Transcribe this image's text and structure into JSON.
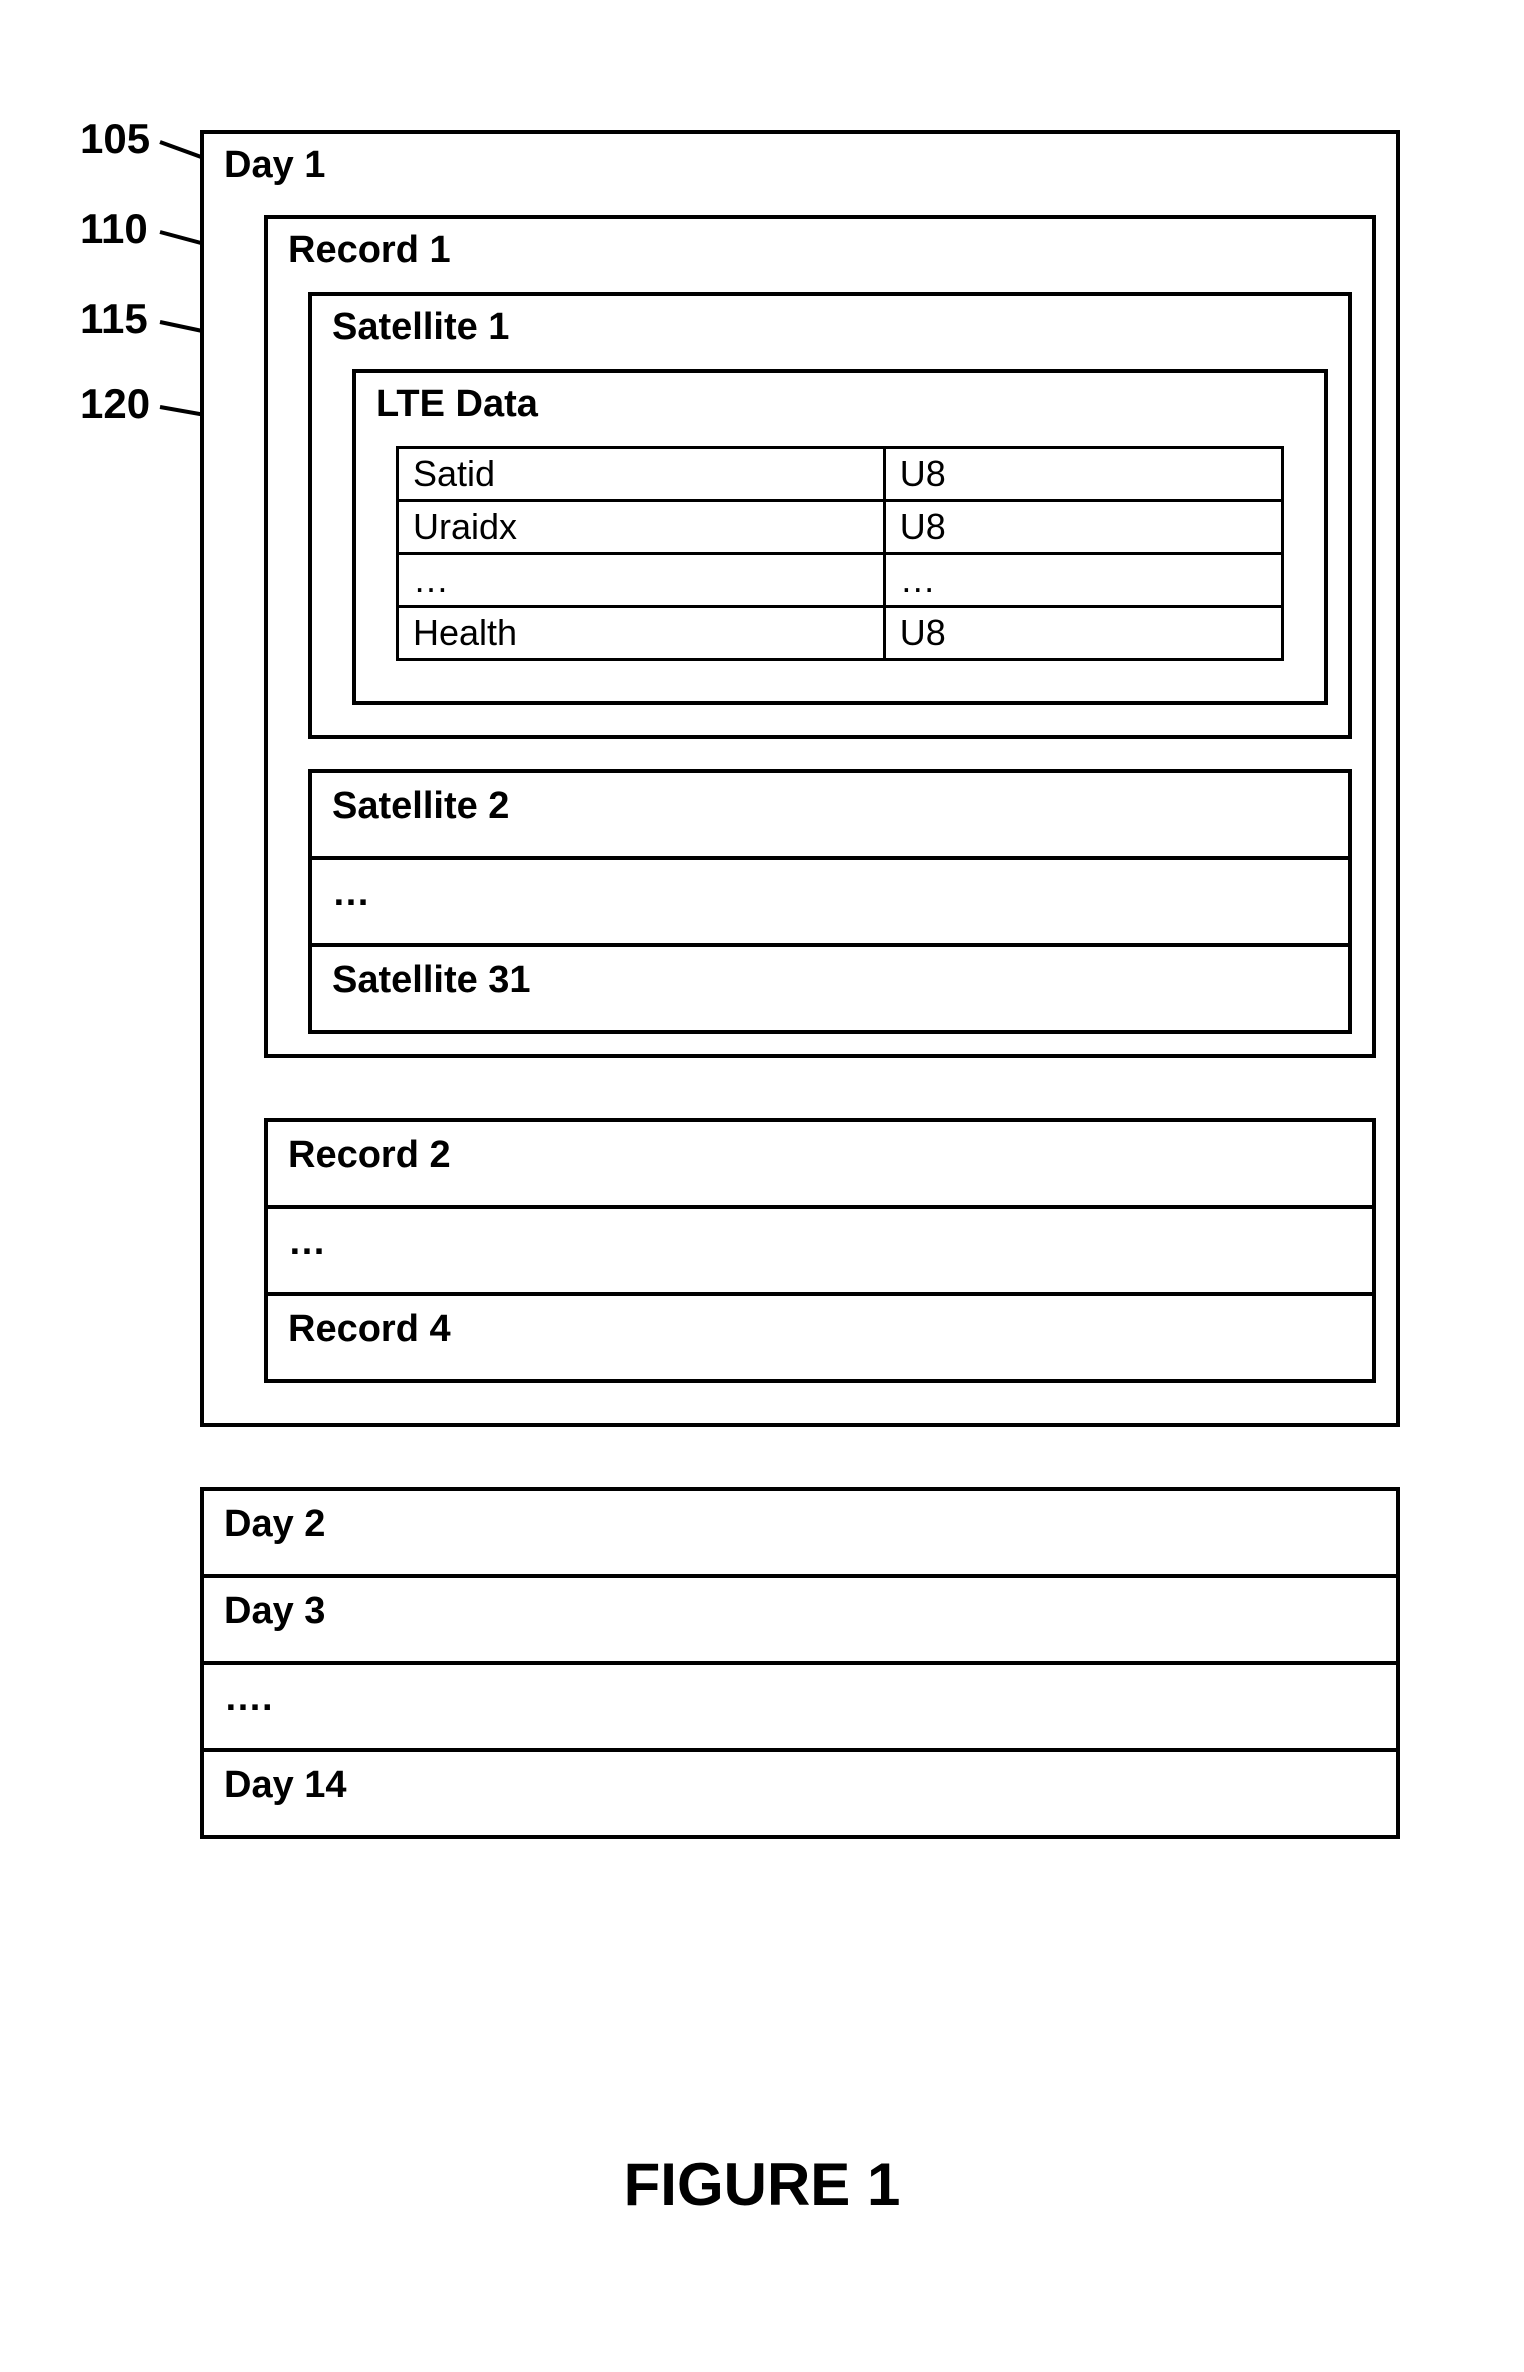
{
  "refs": {
    "r105": "105",
    "r110": "110",
    "r115": "115",
    "r120": "120"
  },
  "day1": {
    "label": "Day 1",
    "record1": {
      "label": "Record 1",
      "sat1": {
        "label": "Satellite 1",
        "lte": {
          "label": "LTE Data",
          "rows": [
            {
              "field": "Satid",
              "type": "U8"
            },
            {
              "field": "Uraidx",
              "type": "U8"
            },
            {
              "field": "…",
              "type": "…"
            },
            {
              "field": "Health",
              "type": "U8"
            }
          ]
        }
      },
      "sats_rest": [
        "Satellite 2",
        "…",
        "Satellite 31"
      ]
    },
    "records_rest": [
      "Record 2",
      "…",
      "Record 4"
    ]
  },
  "days_rest": [
    "Day 2",
    "Day 3",
    "….",
    "Day 14"
  ],
  "caption": "FIGURE 1"
}
